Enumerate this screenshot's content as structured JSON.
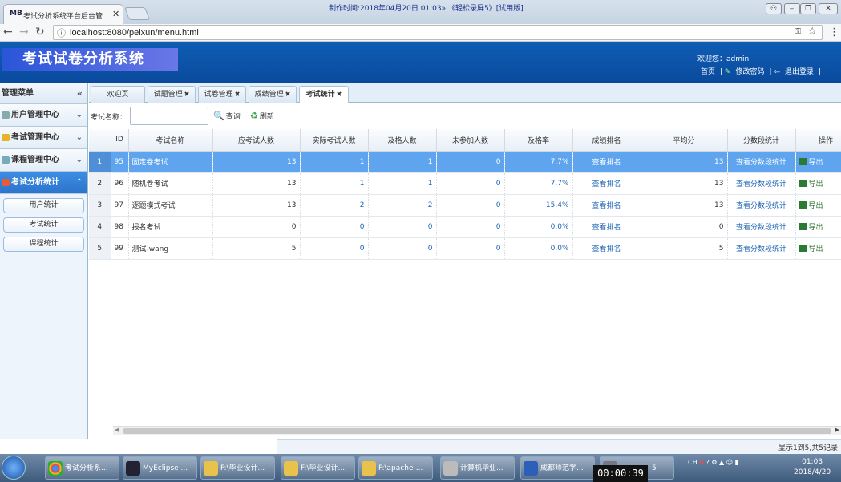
{
  "browser": {
    "tab_badge": "MB",
    "tab_title": "考试分析系统平台后台管",
    "recording_text": "制作时间:2018年04月20日 01:03» 《轻松录屏5》[试用版]",
    "url": "localhost:8080/peixun/menu.html"
  },
  "header": {
    "app_title": "考试试卷分析系统",
    "welcome": "欢迎您：admin",
    "links": [
      "首页",
      "修改密码",
      "退出登录"
    ]
  },
  "sidebar": {
    "title": "管理菜单",
    "groups": [
      {
        "label": "用户管理中心",
        "icon": "users-icon"
      },
      {
        "label": "考试管理中心",
        "icon": "folder-icon"
      },
      {
        "label": "课程管理中心",
        "icon": "book-icon"
      },
      {
        "label": "考试分析统计",
        "icon": "chart-icon"
      }
    ],
    "sub_items": [
      "用户统计",
      "考试统计",
      "课程统计"
    ]
  },
  "tabs": [
    {
      "label": "欢迎页",
      "closable": false
    },
    {
      "label": "试题管理",
      "closable": true
    },
    {
      "label": "试卷管理",
      "closable": true
    },
    {
      "label": "成绩管理",
      "closable": true
    },
    {
      "label": "考试统计",
      "closable": true,
      "active": true
    }
  ],
  "search": {
    "label": "考试名称：",
    "value": "",
    "query_label": "查询",
    "refresh_label": "刷新"
  },
  "table": {
    "columns": [
      "",
      "ID",
      "考试名称",
      "应考试人数",
      "实际考试人数",
      "及格人数",
      "未参加人数",
      "及格率",
      "成绩排名",
      "平均分",
      "分数段统计",
      "操作"
    ],
    "rows": [
      {
        "n": "1",
        "id": "95",
        "name": "固定卷考试",
        "expected": "13",
        "actual": "1",
        "passed": "1",
        "absent": "0",
        "rate": "7.7%",
        "rank": "查看排名",
        "avg": "13",
        "seg": "查看分数段统计",
        "op": "导出"
      },
      {
        "n": "2",
        "id": "96",
        "name": "随机卷考试",
        "expected": "13",
        "actual": "1",
        "passed": "1",
        "absent": "0",
        "rate": "7.7%",
        "rank": "查看排名",
        "avg": "13",
        "seg": "查看分数段统计",
        "op": "导出"
      },
      {
        "n": "3",
        "id": "97",
        "name": "逐题模式考试",
        "expected": "13",
        "actual": "2",
        "passed": "2",
        "absent": "0",
        "rate": "15.4%",
        "rank": "查看排名",
        "avg": "13",
        "seg": "查看分数段统计",
        "op": "导出"
      },
      {
        "n": "4",
        "id": "98",
        "name": "报名考试",
        "expected": "0",
        "actual": "0",
        "passed": "0",
        "absent": "0",
        "rate": "0.0%",
        "rank": "查看排名",
        "avg": "0",
        "seg": "查看分数段统计",
        "op": "导出"
      },
      {
        "n": "5",
        "id": "99",
        "name": "测试-wang",
        "expected": "5",
        "actual": "0",
        "passed": "0",
        "absent": "0",
        "rate": "0.0%",
        "rank": "查看排名",
        "avg": "5",
        "seg": "查看分数段统计",
        "op": "导出"
      }
    ],
    "selected_row": 0
  },
  "pager": {
    "info": "显示1到5,共5记录"
  },
  "taskbar": {
    "items": [
      "考试分析系...",
      "MyEclipse ...",
      "F:\\毕业设计...",
      "F:\\毕业设计...",
      "F:\\apache-...",
      "计算机毕业...",
      "成都师范学...",
      "5"
    ],
    "tray": "CH",
    "time": "01:03",
    "date": "2018/4/20"
  },
  "recording_timer": "00:00:39",
  "colors": {
    "header": "#0f5db5",
    "selected_row": "#5fa4ee",
    "link": "#1e64b4"
  }
}
